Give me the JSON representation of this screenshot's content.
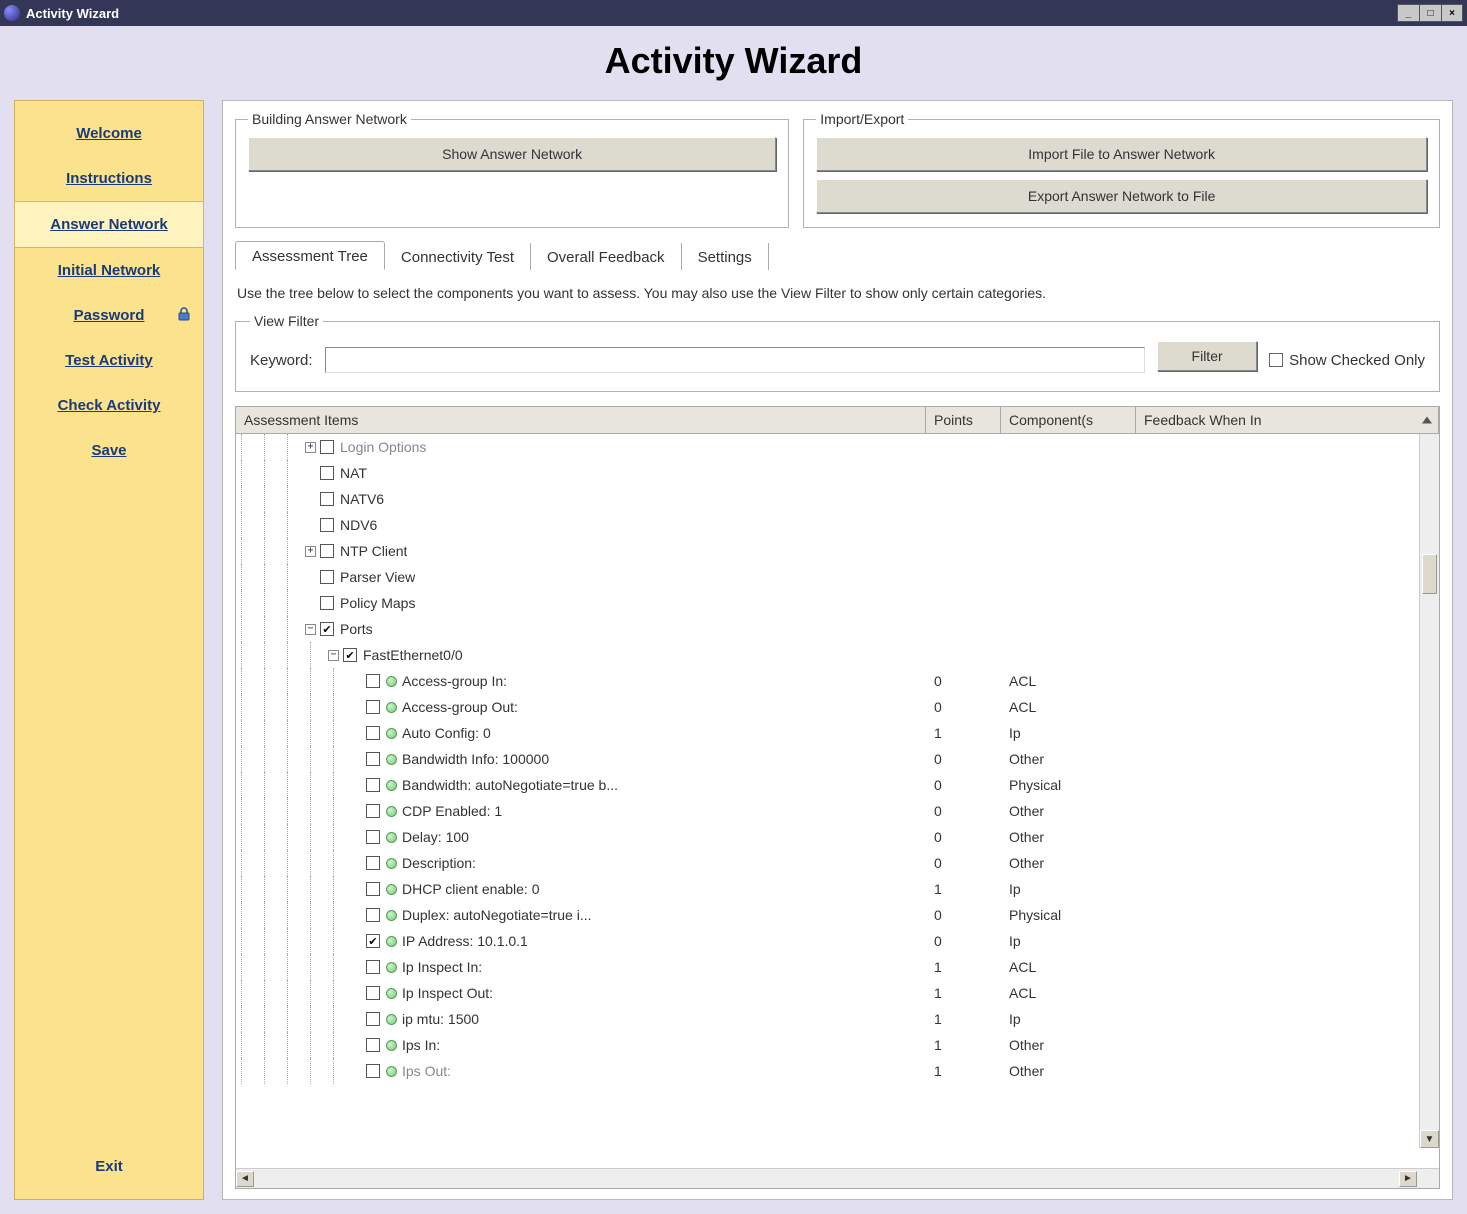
{
  "window": {
    "title": "Activity Wizard"
  },
  "page_title": "Activity Wizard",
  "sidebar": {
    "items": [
      {
        "label": "Welcome",
        "active": false
      },
      {
        "label": "Instructions",
        "active": false
      },
      {
        "label": "Answer Network",
        "active": true
      },
      {
        "label": "Initial Network",
        "active": false
      },
      {
        "label": "Password",
        "active": false,
        "lock": true
      },
      {
        "label": "Test Activity",
        "active": false
      },
      {
        "label": "Check Activity",
        "active": false
      },
      {
        "label": "Save",
        "active": false
      }
    ],
    "exit_label": "Exit"
  },
  "groups": {
    "building": {
      "legend": "Building Answer Network",
      "show_btn": "Show Answer Network"
    },
    "import_export": {
      "legend": "Import/Export",
      "import_btn": "Import File to Answer Network",
      "export_btn": "Export Answer Network to File"
    }
  },
  "tabs": [
    {
      "label": "Assessment Tree",
      "active": true
    },
    {
      "label": "Connectivity Test",
      "active": false
    },
    {
      "label": "Overall Feedback",
      "active": false
    },
    {
      "label": "Settings",
      "active": false
    }
  ],
  "instruction": "Use the tree below to select the components you want to assess. You may also use the View Filter to show only certain categories.",
  "view_filter": {
    "legend": "View Filter",
    "keyword_label": "Keyword:",
    "keyword_value": "",
    "filter_btn": "Filter",
    "show_checked_label": "Show Checked Only",
    "show_checked": false
  },
  "tree": {
    "headers": {
      "c1": "Assessment Items",
      "c2": "Points",
      "c3": "Component(s",
      "c4": "Feedback When In"
    },
    "rows": [
      {
        "depth": 3,
        "expand": "plus",
        "checked": false,
        "led": false,
        "label": "Login Options",
        "points": "",
        "comp": "",
        "cutoff": true
      },
      {
        "depth": 3,
        "expand": "none",
        "checked": false,
        "led": false,
        "label": "NAT",
        "points": "",
        "comp": ""
      },
      {
        "depth": 3,
        "expand": "none",
        "checked": false,
        "led": false,
        "label": "NATV6",
        "points": "",
        "comp": ""
      },
      {
        "depth": 3,
        "expand": "none",
        "checked": false,
        "led": false,
        "label": "NDV6",
        "points": "",
        "comp": ""
      },
      {
        "depth": 3,
        "expand": "plus",
        "checked": false,
        "led": false,
        "label": "NTP Client",
        "points": "",
        "comp": ""
      },
      {
        "depth": 3,
        "expand": "none",
        "checked": false,
        "led": false,
        "label": "Parser View",
        "points": "",
        "comp": ""
      },
      {
        "depth": 3,
        "expand": "none",
        "checked": false,
        "led": false,
        "label": "Policy Maps",
        "points": "",
        "comp": ""
      },
      {
        "depth": 3,
        "expand": "minus",
        "checked": true,
        "led": false,
        "label": "Ports",
        "points": "",
        "comp": ""
      },
      {
        "depth": 4,
        "expand": "minus",
        "checked": true,
        "led": false,
        "label": "FastEthernet0/0",
        "points": "",
        "comp": ""
      },
      {
        "depth": 5,
        "expand": "none",
        "checked": false,
        "led": true,
        "label": "Access-group In:",
        "points": "0",
        "comp": "ACL"
      },
      {
        "depth": 5,
        "expand": "none",
        "checked": false,
        "led": true,
        "label": "Access-group Out:",
        "points": "0",
        "comp": "ACL"
      },
      {
        "depth": 5,
        "expand": "none",
        "checked": false,
        "led": true,
        "label": "Auto Config: 0",
        "points": "1",
        "comp": "Ip"
      },
      {
        "depth": 5,
        "expand": "none",
        "checked": false,
        "led": true,
        "label": "Bandwidth Info: 100000",
        "points": "0",
        "comp": "Other"
      },
      {
        "depth": 5,
        "expand": "none",
        "checked": false,
        "led": true,
        "label": "Bandwidth: autoNegotiate=true b...",
        "points": "0",
        "comp": "Physical"
      },
      {
        "depth": 5,
        "expand": "none",
        "checked": false,
        "led": true,
        "label": "CDP Enabled: 1",
        "points": "0",
        "comp": "Other"
      },
      {
        "depth": 5,
        "expand": "none",
        "checked": false,
        "led": true,
        "label": "Delay: 100",
        "points": "0",
        "comp": "Other"
      },
      {
        "depth": 5,
        "expand": "none",
        "checked": false,
        "led": true,
        "label": "Description:",
        "points": "0",
        "comp": "Other"
      },
      {
        "depth": 5,
        "expand": "none",
        "checked": false,
        "led": true,
        "label": "DHCP client enable: 0",
        "points": "1",
        "comp": "Ip"
      },
      {
        "depth": 5,
        "expand": "none",
        "checked": false,
        "led": true,
        "label": "Duplex: autoNegotiate=true i...",
        "points": "0",
        "comp": "Physical"
      },
      {
        "depth": 5,
        "expand": "none",
        "checked": true,
        "led": true,
        "label": "IP Address: 10.1.0.1",
        "points": "0",
        "comp": "Ip"
      },
      {
        "depth": 5,
        "expand": "none",
        "checked": false,
        "led": true,
        "label": "Ip Inspect In:",
        "points": "1",
        "comp": "ACL"
      },
      {
        "depth": 5,
        "expand": "none",
        "checked": false,
        "led": true,
        "label": "Ip Inspect Out:",
        "points": "1",
        "comp": "ACL"
      },
      {
        "depth": 5,
        "expand": "none",
        "checked": false,
        "led": true,
        "label": "ip mtu: 1500",
        "points": "1",
        "comp": "Ip"
      },
      {
        "depth": 5,
        "expand": "none",
        "checked": false,
        "led": true,
        "label": "Ips In:",
        "points": "1",
        "comp": "Other"
      },
      {
        "depth": 5,
        "expand": "none",
        "checked": false,
        "led": true,
        "label": "Ips Out:",
        "points": "1",
        "comp": "Other",
        "cutoff": true
      }
    ]
  }
}
